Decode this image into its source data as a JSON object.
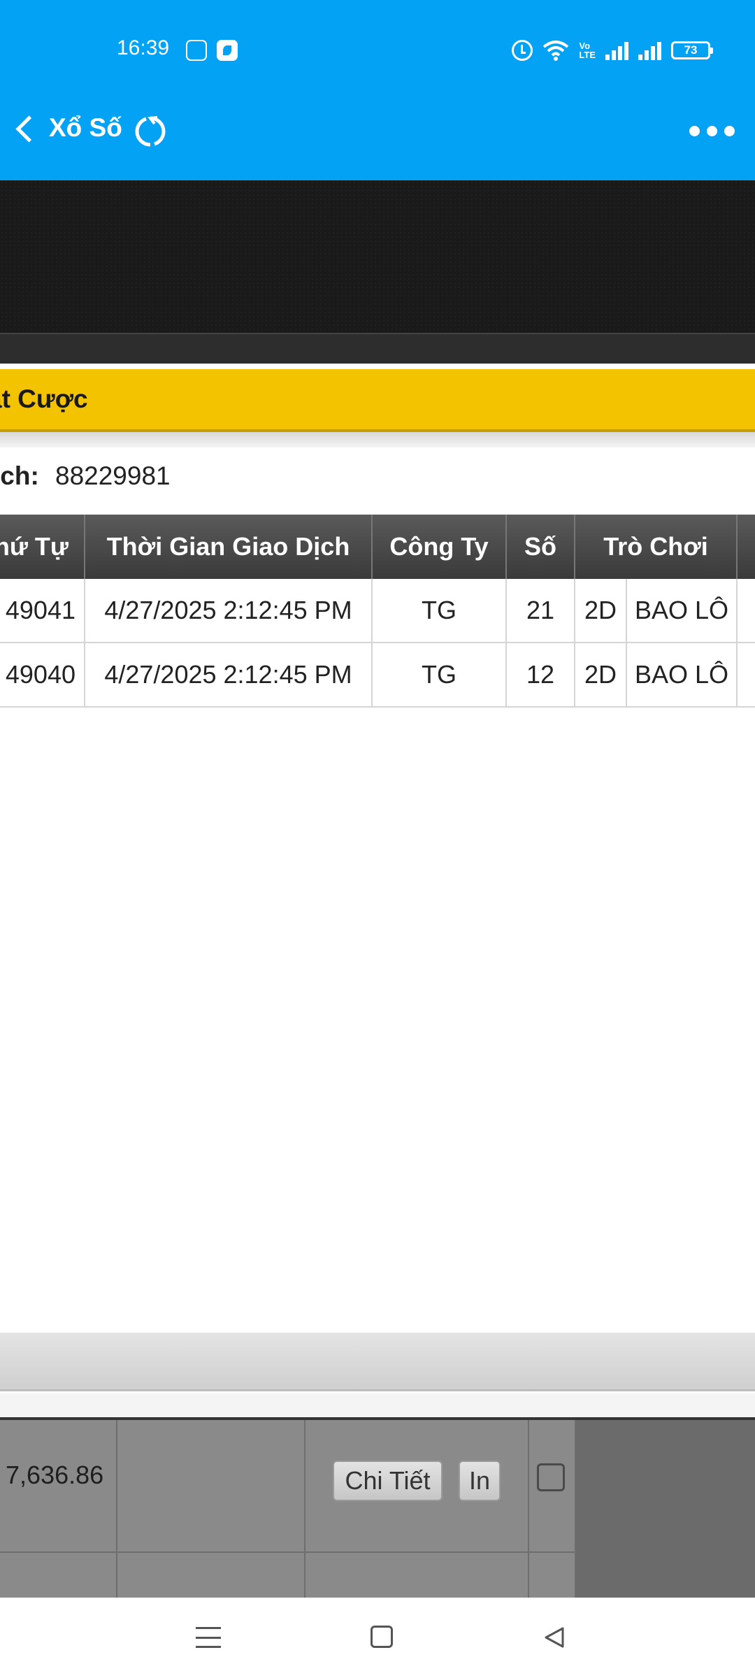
{
  "status_bar": {
    "time": "16:39",
    "volte_label": "Vo\nLTE",
    "battery": "73",
    "icons": [
      "app-icon-1",
      "app-icon-2",
      "alarm-icon",
      "wifi-icon",
      "volte-icon",
      "signal-icon",
      "signal-icon",
      "battery-icon"
    ]
  },
  "app_bar": {
    "title": "Xổ Số",
    "icons": [
      "back-icon",
      "refresh-icon",
      "more-icon"
    ]
  },
  "panel": {
    "title": "ặt Cược"
  },
  "ticket": {
    "label": "ịch:",
    "value": "88229981"
  },
  "table": {
    "headers": [
      "hứ Tự",
      "Thời Gian Giao Dịch",
      "Công Ty",
      "Số",
      "Trò Chơi"
    ],
    "rows": [
      {
        "id": "49041",
        "time": "4/27/2025 2:12:45 PM",
        "company": "TG",
        "number": "21",
        "type": "2D",
        "game": "BAO LÔ"
      },
      {
        "id": "49040",
        "time": "4/27/2025 2:12:45 PM",
        "company": "TG",
        "number": "12",
        "type": "2D",
        "game": "BAO LÔ"
      }
    ]
  },
  "lower_list": {
    "amount": "7,636.86",
    "detail_button": "Chi Tiết",
    "print_button": "In"
  },
  "nav_bar": {
    "icons": [
      "menu-icon",
      "home-icon",
      "back-icon"
    ]
  }
}
